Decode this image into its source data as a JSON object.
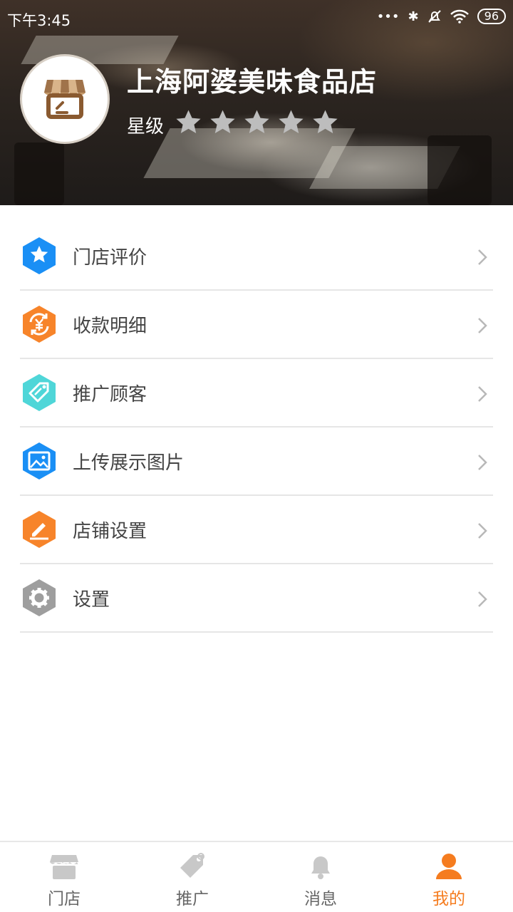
{
  "status_bar": {
    "time": "下午3:45",
    "battery": "96"
  },
  "store": {
    "name": "上海阿婆美味食品店",
    "rating_label": "星级",
    "rating": 0,
    "rating_max": 5
  },
  "menu": [
    {
      "label": "门店评价",
      "icon": "star-icon",
      "color": "#1a8ff5"
    },
    {
      "label": "收款明细",
      "icon": "yuan-exchange-icon",
      "color": "#f7842a"
    },
    {
      "label": "推广顾客",
      "icon": "tag-icon",
      "color": "#4fd6d8"
    },
    {
      "label": "上传展示图片",
      "icon": "image-icon",
      "color": "#1a8ff5"
    },
    {
      "label": "店铺设置",
      "icon": "pencil-icon",
      "color": "#f7842a"
    },
    {
      "label": "设置",
      "icon": "gear-icon",
      "color": "#9e9e9e"
    }
  ],
  "bottom_nav": [
    {
      "label": "门店",
      "icon": "store-icon",
      "active": false
    },
    {
      "label": "推广",
      "icon": "tag-icon",
      "active": false
    },
    {
      "label": "消息",
      "icon": "bell-icon",
      "active": false
    },
    {
      "label": "我的",
      "icon": "user-icon",
      "active": true
    }
  ],
  "colors": {
    "accent": "#f57c1f",
    "inactive_nav": "#c8c8c8",
    "star_inactive": "#bdbdbd"
  }
}
